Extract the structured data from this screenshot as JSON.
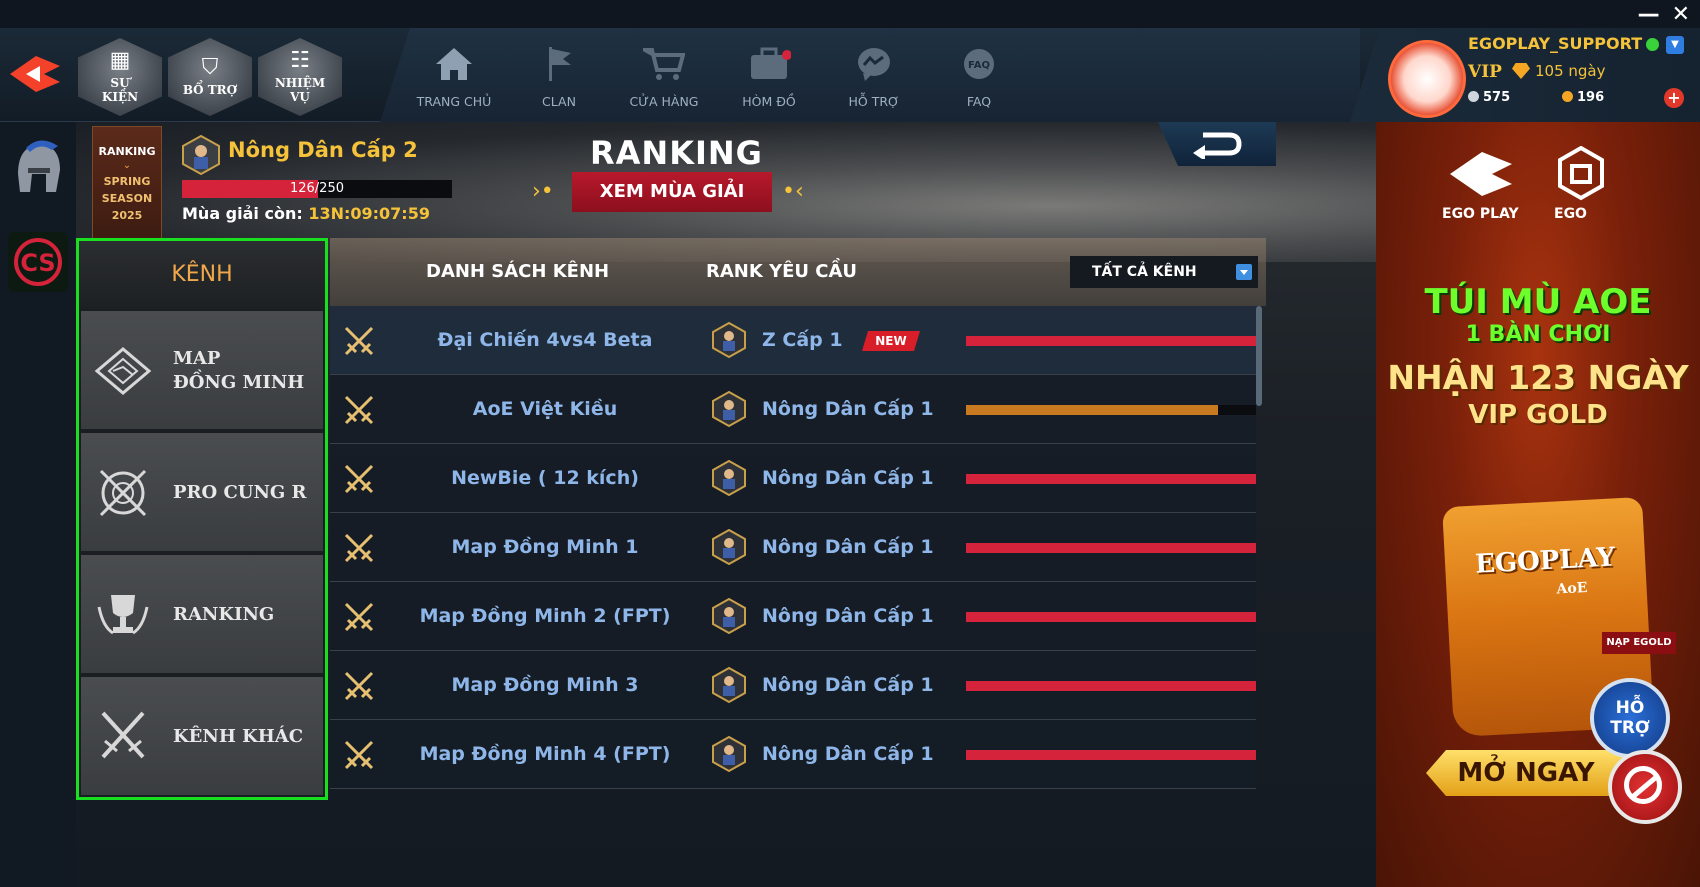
{
  "window": {
    "minimize": "—",
    "close": "✕"
  },
  "hex_buttons": [
    {
      "label": "SỰ\nKIỆN",
      "icon": "calendar-icon"
    },
    {
      "label": "BỔ TRỢ",
      "icon": "shield-check-icon"
    },
    {
      "label": "NHIỆM\nVỤ",
      "icon": "clipboard-icon"
    }
  ],
  "nav": [
    {
      "label": "TRANG CHỦ",
      "icon": "home-icon"
    },
    {
      "label": "CLAN",
      "icon": "flag-icon"
    },
    {
      "label": "CỬA HÀNG",
      "icon": "cart-icon"
    },
    {
      "label": "HÒM ĐỒ",
      "icon": "chest-icon"
    },
    {
      "label": "HỖ TRỢ",
      "icon": "messenger-icon"
    },
    {
      "label": "FAQ",
      "icon": "faq-icon"
    }
  ],
  "user": {
    "name": "EGOPLAY_SUPPORT",
    "vip": "VIP",
    "vip_days": "105 ngày",
    "silver": "575",
    "gold": "196",
    "plus": "+",
    "dropdown": "▼"
  },
  "season_tag": {
    "title": "RANKING",
    "arrow": "⌄",
    "season": "SPRING\nSEASON\n2025"
  },
  "player_rank": {
    "name": "Nông Dân Cấp 2",
    "xp": 126,
    "xp_max": 250,
    "xp_text": "126/250"
  },
  "season_left": {
    "label": "Mùa giải còn:",
    "value": "13N:09:07:59"
  },
  "page_title": "RANKING",
  "season_button": "XEM MÙA GIẢI",
  "deco_left": "›•",
  "deco_right": "•‹",
  "sidebar": {
    "header": "KÊNH",
    "items": [
      {
        "label": "MAP\nĐỒNG MINH",
        "icon": "map-diamond-icon"
      },
      {
        "label": "PRO CUNG R",
        "icon": "crossbow-target-icon"
      },
      {
        "label": "RANKING",
        "icon": "trophy-icon"
      },
      {
        "label": "KÊNH KHÁC",
        "icon": "crossed-swords-icon"
      }
    ]
  },
  "table": {
    "col_channels": "DANH SÁCH KÊNH",
    "col_rank": "RANK YÊU CẦU",
    "filter": "TẤT CẢ KÊNH",
    "rows": [
      {
        "channel": "Đại Chiến 4vs4 Beta",
        "rank": "Z Cấp 1",
        "badge": "NEW",
        "fill": 1.0,
        "color": "#d4233a"
      },
      {
        "channel": "AoE Việt Kiều",
        "rank": "Nông Dân Cấp 1",
        "badge": "",
        "fill": 0.87,
        "color": "#c9791f"
      },
      {
        "channel": "NewBie ( 12 kích)",
        "rank": "Nông Dân Cấp 1",
        "badge": "",
        "fill": 1.0,
        "color": "#d4233a"
      },
      {
        "channel": "Map Đồng Minh 1",
        "rank": "Nông Dân Cấp 1",
        "badge": "",
        "fill": 1.0,
        "color": "#d4233a"
      },
      {
        "channel": "Map Đồng Minh 2 (FPT)",
        "rank": "Nông Dân Cấp 1",
        "badge": "",
        "fill": 1.0,
        "color": "#d4233a"
      },
      {
        "channel": "Map Đồng Minh 3",
        "rank": "Nông Dân Cấp 1",
        "badge": "",
        "fill": 1.0,
        "color": "#d4233a"
      },
      {
        "channel": "Map Đồng Minh 4 (FPT)",
        "rank": "Nông Dân Cấp 1",
        "badge": "",
        "fill": 1.0,
        "color": "#d4233a"
      }
    ]
  },
  "ad": {
    "brand1": "EGO PLAY",
    "brand2": "EGO",
    "line1": "TÚI MÙ AOE",
    "line2": "1 BÀN CHƠI",
    "line3": "NHẬN 123 NGÀY",
    "line4": "VIP GOLD",
    "bag_text": "EGOPLAY",
    "bag_sub": "AoE",
    "nap": "NẠP EGOLD",
    "support": "HỖ\nTRỢ",
    "open_now": "MỞ NGAY"
  }
}
